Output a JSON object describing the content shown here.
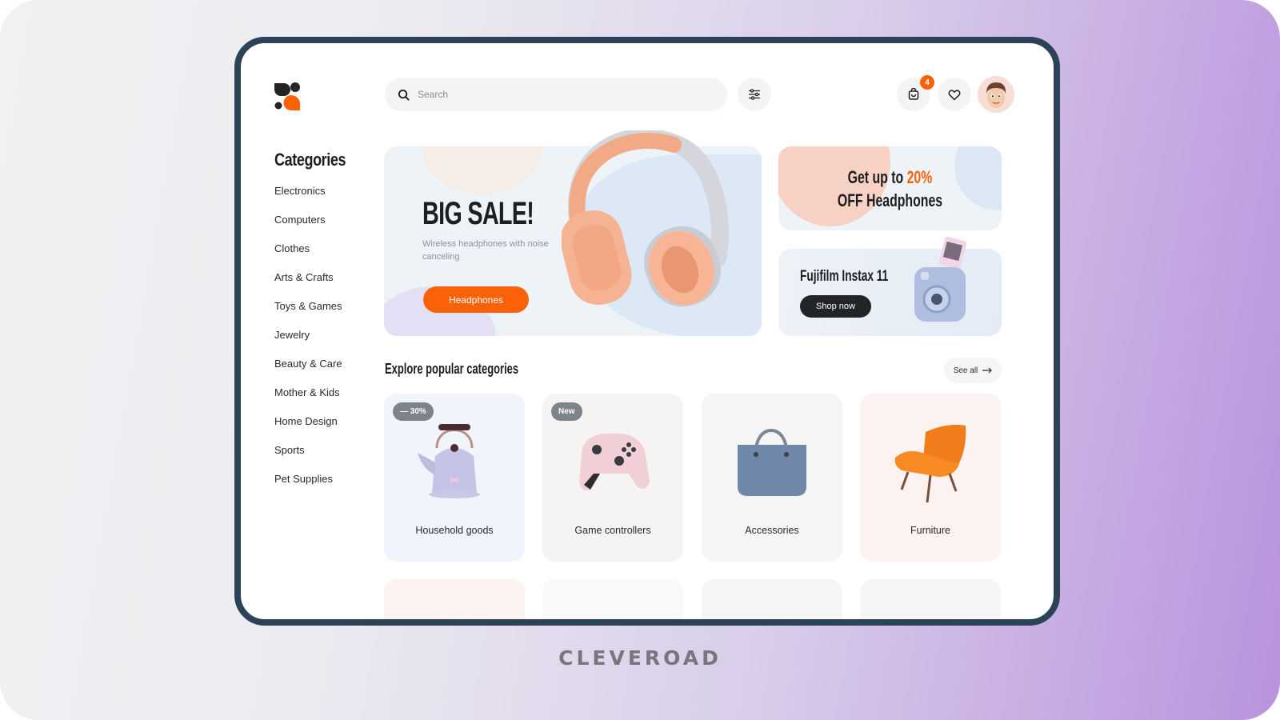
{
  "header": {
    "search_placeholder": "Search",
    "cart_count": "4"
  },
  "sidebar": {
    "title": "Categories",
    "items": [
      {
        "label": "Electronics"
      },
      {
        "label": "Computers"
      },
      {
        "label": "Clothes"
      },
      {
        "label": "Arts & Crafts"
      },
      {
        "label": "Toys & Games"
      },
      {
        "label": "Jewelry"
      },
      {
        "label": "Beauty & Care"
      },
      {
        "label": "Mother & Kids"
      },
      {
        "label": "Home Design"
      },
      {
        "label": "Sports"
      },
      {
        "label": "Pet Supplies"
      }
    ]
  },
  "hero": {
    "title": "BIG SALE!",
    "subtitle": "Wireless headphones with noise canceling",
    "button_label": "Headphones"
  },
  "promo_discount": {
    "line1_prefix": "Get up to ",
    "line1_accent": "20%",
    "line2": "OFF Headphones"
  },
  "promo_camera": {
    "title": "Fujifilm Instax 11",
    "button_label": "Shop now"
  },
  "popular": {
    "title": "Explore popular categories",
    "see_all_label": "See all",
    "cards": [
      {
        "label": "Household goods",
        "badge": "— 30%",
        "bg": "#f0f5fb"
      },
      {
        "label": "Game controllers",
        "badge": "New",
        "bg": "#f6f3f3"
      },
      {
        "label": "Accessories",
        "badge": "",
        "bg": "#f5f5f6"
      },
      {
        "label": "Furniture",
        "badge": "",
        "bg": "#fcf3f0"
      }
    ],
    "next_row_bgs": [
      "#fcf3f0",
      "#f9f8fb",
      "#f6f6f7",
      "#f6f6f7"
    ]
  },
  "colors": {
    "accent": "#fb6107",
    "frame": "#2b4257",
    "dark": "#1e1e20"
  },
  "watermark": "CLEVEROAD"
}
